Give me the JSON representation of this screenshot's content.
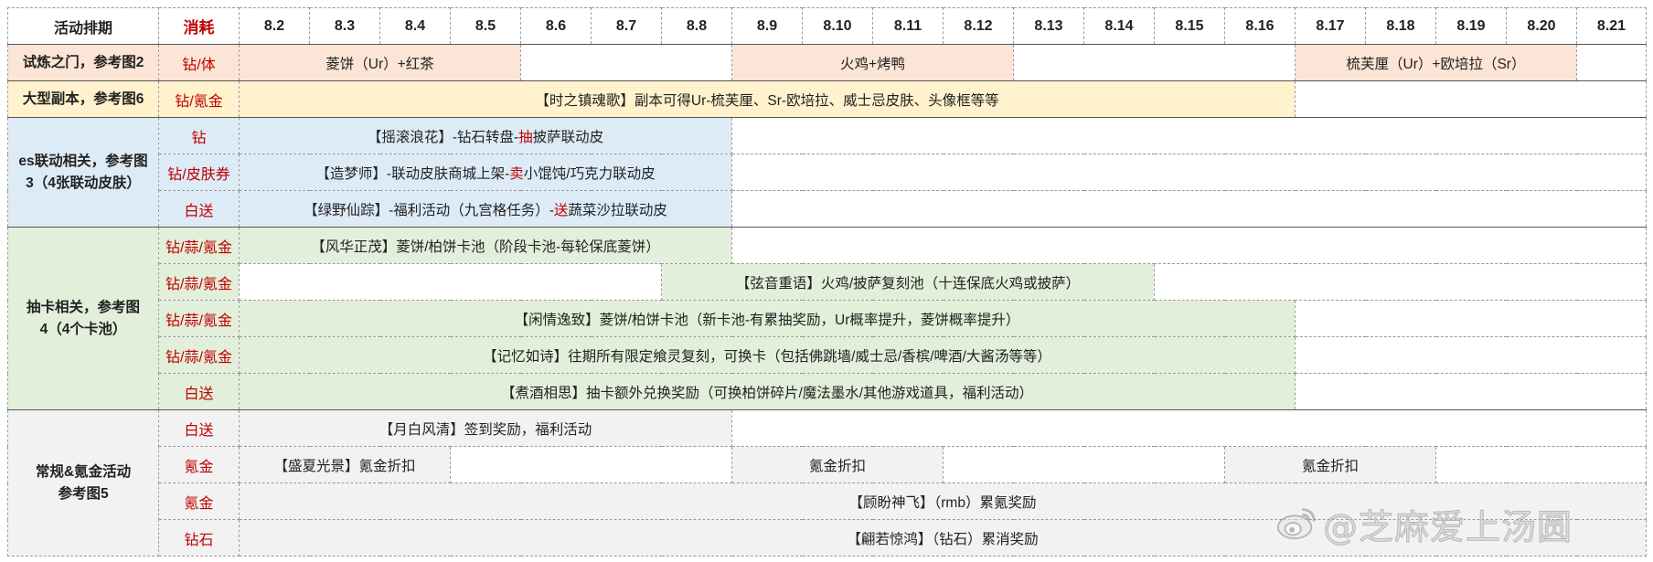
{
  "header": {
    "activity": "活动排期",
    "cost": "消耗",
    "dates": [
      "8.2",
      "8.3",
      "8.4",
      "8.5",
      "8.6",
      "8.7",
      "8.8",
      "8.9",
      "8.10",
      "8.11",
      "8.12",
      "8.13",
      "8.14",
      "8.15",
      "8.16",
      "8.17",
      "8.18",
      "8.19",
      "8.20",
      "8.21"
    ]
  },
  "categories": {
    "trial": "试炼之门，参考图2",
    "dungeon": "大型副本，参考图6",
    "es": "es联动相关，参考图3（4张联动皮肤）",
    "gacha": "抽卡相关，参考图4（4个卡池）",
    "regular_line1": "常规&氪金活动",
    "regular_line2": "参考图5"
  },
  "rows": {
    "trial": {
      "cost": "钻/体",
      "events": [
        "菱饼（Ur）+红茶",
        "火鸡+烤鸭",
        "梳芙厘（Ur）+欧培拉（Sr）"
      ]
    },
    "dungeon": {
      "cost": "钻/氪金",
      "event": "【时之镇魂歌】副本可得Ur-梳芙厘、Sr-欧培拉、威士忌皮肤、头像框等等"
    },
    "es1": {
      "cost": "钻",
      "event_a": "【摇滚浪花】-钻石转盘-",
      "event_hl": "抽",
      "event_b": "披萨联动皮"
    },
    "es2": {
      "cost": "钻/皮肤券",
      "event_a": "【造梦师】-联动皮肤商城上架-",
      "event_hl": "卖",
      "event_b": "小馄饨/巧克力联动皮"
    },
    "es3": {
      "cost": "白送",
      "event_a": "【绿野仙踪】-福利活动（九宫格任务）-",
      "event_hl": "送",
      "event_b": "蔬菜沙拉联动皮"
    },
    "gacha1": {
      "cost": "钻/蒜/氪金",
      "event": "【风华正茂】菱饼/柏饼卡池（阶段卡池-每轮保底菱饼）"
    },
    "gacha2": {
      "cost": "钻/蒜/氪金",
      "event": "【弦音重语】火鸡/披萨复刻池（十连保底火鸡或披萨）"
    },
    "gacha3": {
      "cost": "钻/蒜/氪金",
      "event": "【闲情逸致】菱饼/柏饼卡池（新卡池-有累抽奖励，Ur概率提升，菱饼概率提升）"
    },
    "gacha4": {
      "cost": "钻/蒜/氪金",
      "event": "【记忆如诗】往期所有限定飨灵复刻，可换卡（包括佛跳墙/威士忌/香槟/啤酒/大酱汤等等）"
    },
    "gacha5": {
      "cost": "白送",
      "event": "【煮酒相思】抽卡额外兑换奖励（可换柏饼碎片/魔法墨水/其他游戏道具，福利活动）"
    },
    "reg1": {
      "cost": "白送",
      "event": "【月白风清】签到奖励，福利活动"
    },
    "reg2": {
      "cost": "氪金",
      "events": [
        "【盛夏光景】氪金折扣",
        "氪金折扣",
        "氪金折扣"
      ]
    },
    "reg3": {
      "cost": "氪金",
      "event": "【顾盼神飞】（rmb）累氪奖励"
    },
    "reg4": {
      "cost": "钻石",
      "event": "【翩若惊鸿】（钻石）累消奖励"
    }
  },
  "watermark": {
    "text": "@芝麻爱上汤圆",
    "icon": "weibo-logo-icon"
  },
  "colors": {
    "red_text": "#c00000",
    "pink": "#fce4d6",
    "yellow": "#fff2cc",
    "blue": "#ddebf7",
    "green": "#e2efda",
    "grey": "#f2f2f2"
  }
}
